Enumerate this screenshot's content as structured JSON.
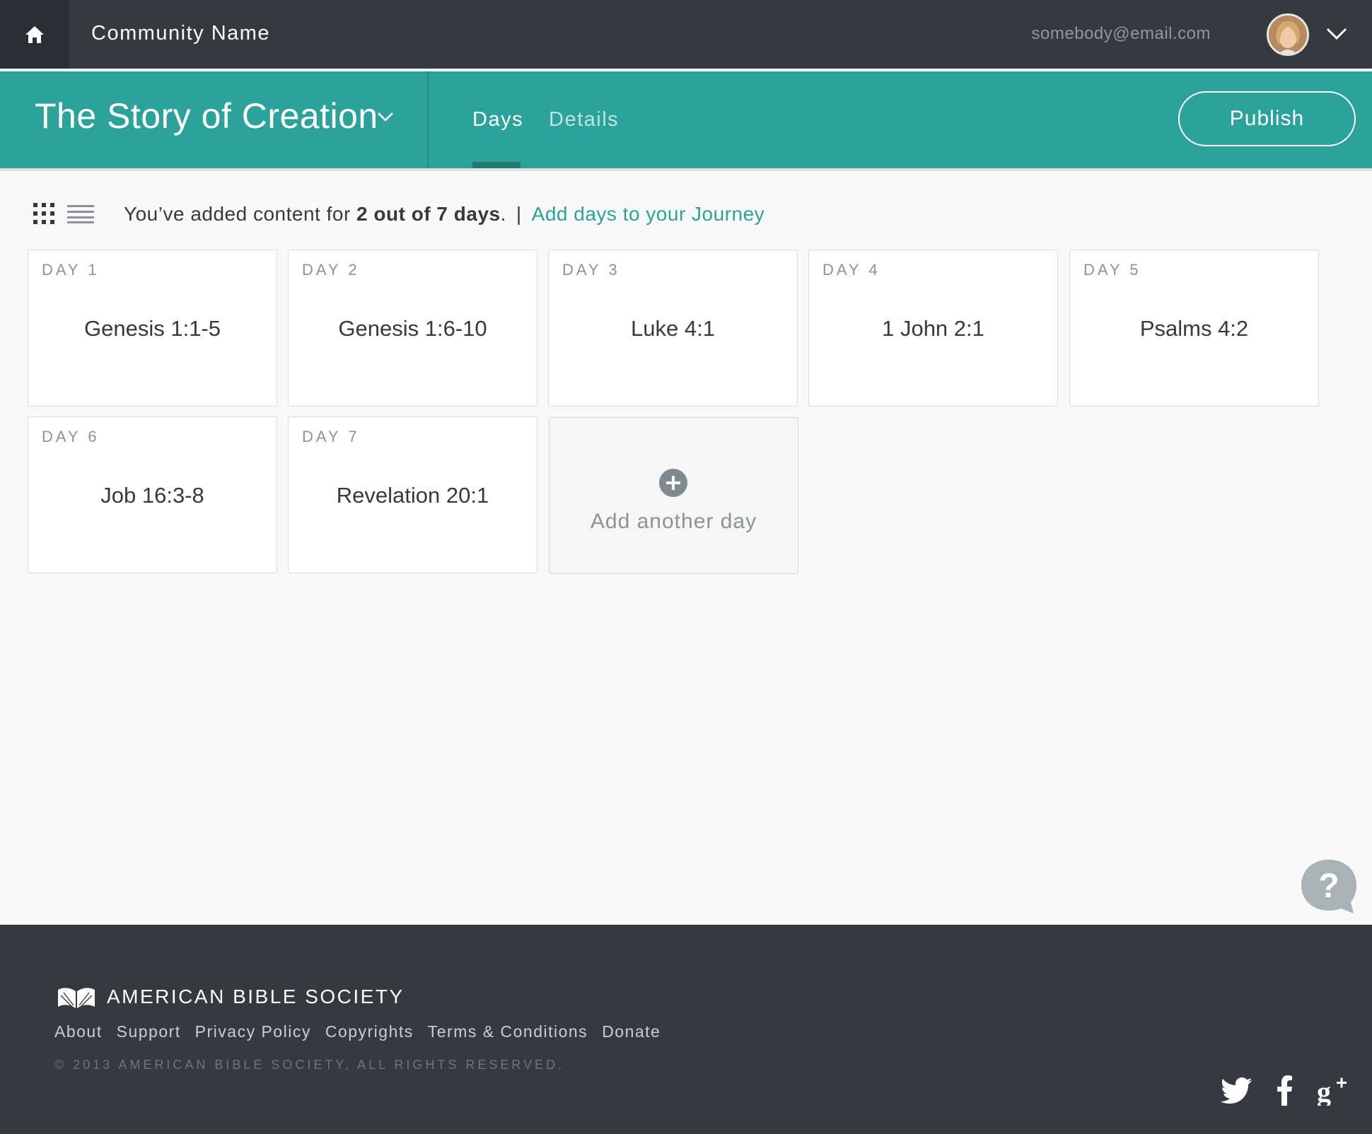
{
  "topbar": {
    "community_name": "Community Name",
    "email": "somebody@email.com"
  },
  "header": {
    "title": "The Story of Creation",
    "tabs": [
      {
        "label": "Days",
        "active": true
      },
      {
        "label": "Details",
        "active": false
      }
    ],
    "publish_label": "Publish"
  },
  "summary": {
    "prefix": "You’ve added content for ",
    "count": "2 out of 7 days",
    "suffix": ".",
    "separator": "|",
    "add_link": "Add days to your Journey"
  },
  "days": [
    {
      "label": "DAY 1",
      "reference": "Genesis 1:1-5"
    },
    {
      "label": "DAY 2",
      "reference": "Genesis 1:6-10"
    },
    {
      "label": "DAY 3",
      "reference": "Luke 4:1"
    },
    {
      "label": "DAY 4",
      "reference": "1 John 2:1"
    },
    {
      "label": "DAY 5",
      "reference": "Psalms 4:2"
    },
    {
      "label": "DAY 6",
      "reference": "Job 16:3-8"
    },
    {
      "label": "DAY 7",
      "reference": "Revelation 20:1"
    }
  ],
  "add_day_label": "Add another day",
  "footer": {
    "org_name": "AMERICAN BIBLE SOCIETY",
    "links": [
      "About",
      "Support",
      "Privacy Policy",
      "Copyrights",
      "Terms & Conditions",
      "Donate"
    ],
    "copyright": "© 2013 AMERICAN BIBLE SOCIETY, ALL RIGHTS RESERVED.",
    "social": [
      "twitter-icon",
      "facebook-icon",
      "google-plus-icon"
    ]
  },
  "colors": {
    "teal": "#2ba39a",
    "dark": "#343a3e",
    "background": "#f9f9f9"
  }
}
